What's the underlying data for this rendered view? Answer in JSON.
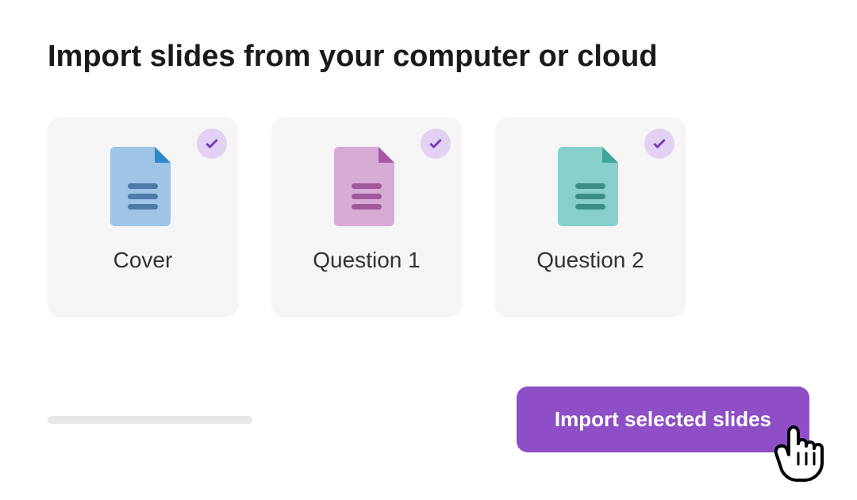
{
  "title": "Import slides from your computer or cloud",
  "cards": [
    {
      "label": "Cover",
      "icon_fill": "#9ec4e6",
      "icon_fold": "#2f88c9",
      "icon_lines": "#4d7aa6",
      "selected": true
    },
    {
      "label": "Question 1",
      "icon_fill": "#d8aad6",
      "icon_fold": "#a657a2",
      "icon_lines": "#9e5a9b",
      "selected": true
    },
    {
      "label": "Question 2",
      "icon_fill": "#86d0c9",
      "icon_fold": "#3ea69a",
      "icon_lines": "#3b8e84",
      "selected": true
    }
  ],
  "colors": {
    "accent": "#8e4ec6",
    "check_bg": "#e1d1f2",
    "check_tick": "#7a3fb5"
  },
  "import_button_label": "Import selected slides"
}
